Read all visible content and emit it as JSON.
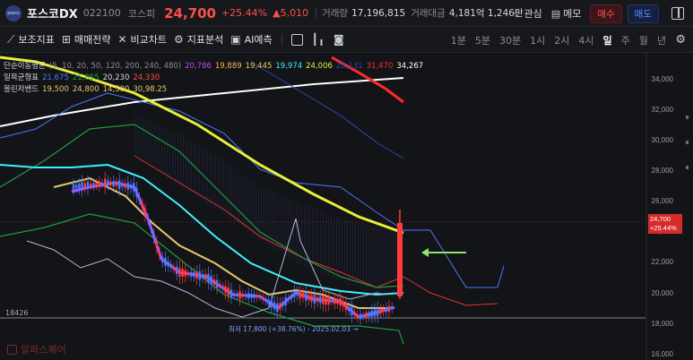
{
  "header": {
    "stock_name": "포스코DX",
    "stock_code": "022100",
    "market": "코스피",
    "price": "24,700",
    "change_pct": "+25.44%",
    "change_abs": "▲5,010",
    "volume_label": "거래량",
    "volume_value": "17,196,815",
    "amount_label": "거래대금",
    "amount_value": "4,181억 1,246만",
    "watch_label": "관심",
    "memo_label": "메모",
    "buy_label": "매수",
    "sell_label": "매도"
  },
  "toolbar": {
    "tools": [
      "보조지표",
      "매매전략",
      "비교차트",
      "지표분석",
      "AI예측"
    ],
    "periods": [
      "1분",
      "5분",
      "30분",
      "1시",
      "2시",
      "4시",
      "일",
      "주",
      "월",
      "년"
    ],
    "active_period": "일"
  },
  "legend": {
    "ma": {
      "label": "단순이동평균",
      "params": "(5, 10, 20, 50, 120, 200, 240, 480)",
      "values": [
        "20,786",
        "19,889",
        "19,445",
        "19,974",
        "24,006",
        "28,131",
        "31,470",
        "34,267"
      ]
    },
    "ichimoku": {
      "label": "일목균형표",
      "values": [
        "21,675",
        "21,855",
        "20,230",
        "24,330"
      ]
    },
    "bollinger": {
      "label": "볼린저밴드",
      "values": [
        "19,500",
        "24,800",
        "14,500",
        "30,98.25"
      ]
    }
  },
  "colors": {
    "up": "#ff4d4d",
    "down": "#5d8cff",
    "ma5": "#b64dff",
    "ma10": "#ffb04d",
    "ma20": "#e6c86e",
    "ma50": "#3ff0ff",
    "ma120": "#e8ef3a",
    "ma200": "#6b8cff",
    "ma240": "#ff2b2b",
    "ma480": "#ffffff"
  },
  "chart_data": {
    "type": "candlestick",
    "y_axis": [
      "34,000",
      "32,000",
      "30,000",
      "28,000",
      "26,000",
      "24,000",
      "22,000",
      "20,000",
      "18,000",
      "16,000"
    ],
    "ylim": [
      16000,
      35000
    ],
    "last_price_tag": [
      "24,700",
      "+25.44%"
    ],
    "base_label": "18426",
    "low_annotation": "최저 17,800 (+38.76%) - 2025.02.03 →"
  },
  "watermark": "알파스퀘어"
}
